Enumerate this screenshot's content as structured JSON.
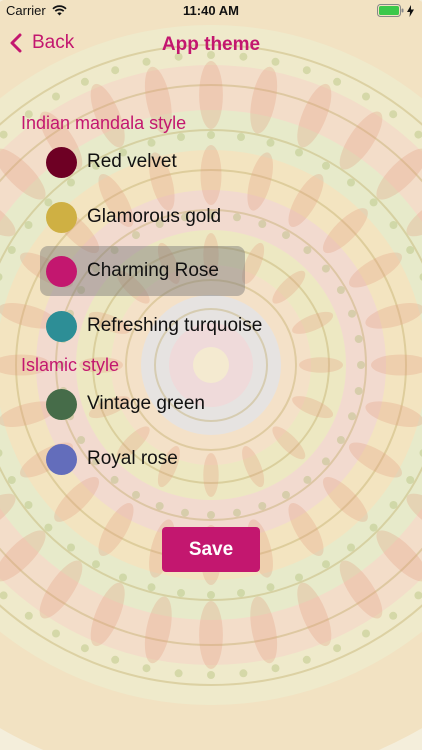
{
  "status_bar": {
    "carrier": "Carrier",
    "time": "11:40 AM",
    "wifi_icon": "wifi-icon",
    "battery_icon": "battery-icon",
    "battery_color": "#3cc84a"
  },
  "nav": {
    "back_label": "Back",
    "back_icon": "chevron-left-icon",
    "title": "App theme"
  },
  "sections": [
    {
      "title": "Indian mandala style",
      "themes": [
        {
          "label": "Red velvet",
          "color": "#6e0024",
          "selected": false
        },
        {
          "label": "Glamorous gold",
          "color": "#cfb043",
          "selected": false
        },
        {
          "label": "Charming Rose",
          "color": "#c3176f",
          "selected": true
        },
        {
          "label": "Refreshing turquoise",
          "color": "#2d8e96",
          "selected": false
        }
      ]
    },
    {
      "title": "Islamic style",
      "themes": [
        {
          "label": "Vintage green",
          "color": "#466c49",
          "selected": false
        },
        {
          "label": "Royal rose",
          "color": "#636dbb",
          "selected": false
        }
      ]
    }
  ],
  "save_label": "Save",
  "accent_color": "#c3176f"
}
